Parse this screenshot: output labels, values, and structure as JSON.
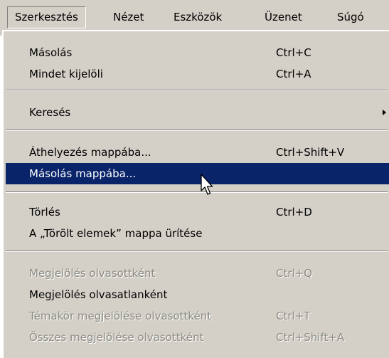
{
  "menubar": {
    "items": [
      {
        "label": "Szerkesztés"
      },
      {
        "label": "Nézet"
      },
      {
        "label": "Eszközök"
      },
      {
        "label": "Üzenet"
      },
      {
        "label": "Súgó"
      }
    ]
  },
  "menu": {
    "items": [
      {
        "label": "Másolás",
        "shortcut": "Ctrl+C"
      },
      {
        "label": "Mindet kijelöli",
        "shortcut": "Ctrl+A"
      },
      {
        "label": "Keresés",
        "shortcut": ""
      },
      {
        "label": "Áthelyezés mappába...",
        "shortcut": "Ctrl+Shift+V"
      },
      {
        "label": "Másolás mappába...",
        "shortcut": ""
      },
      {
        "label": "Törlés",
        "shortcut": "Ctrl+D"
      },
      {
        "label": "A „Törölt elemek” mappa ürítése",
        "shortcut": ""
      },
      {
        "label": "Megjelölés olvasottként",
        "shortcut": "Ctrl+Q"
      },
      {
        "label": "Megjelölés olvasatlanként",
        "shortcut": ""
      },
      {
        "label": "Témakör megjelölése olvasottként",
        "shortcut": "Ctrl+T"
      },
      {
        "label": "Összes megjelölése olvasottként",
        "shortcut": "Ctrl+Shift+A"
      }
    ]
  },
  "icons": {
    "submenu": "chevron-right-icon",
    "pointer": "mouse-pointer-icon"
  },
  "colors": {
    "menu_bg": "#d4d0c8",
    "highlight": "#0a246a",
    "disabled_text": "#8c8b84"
  }
}
